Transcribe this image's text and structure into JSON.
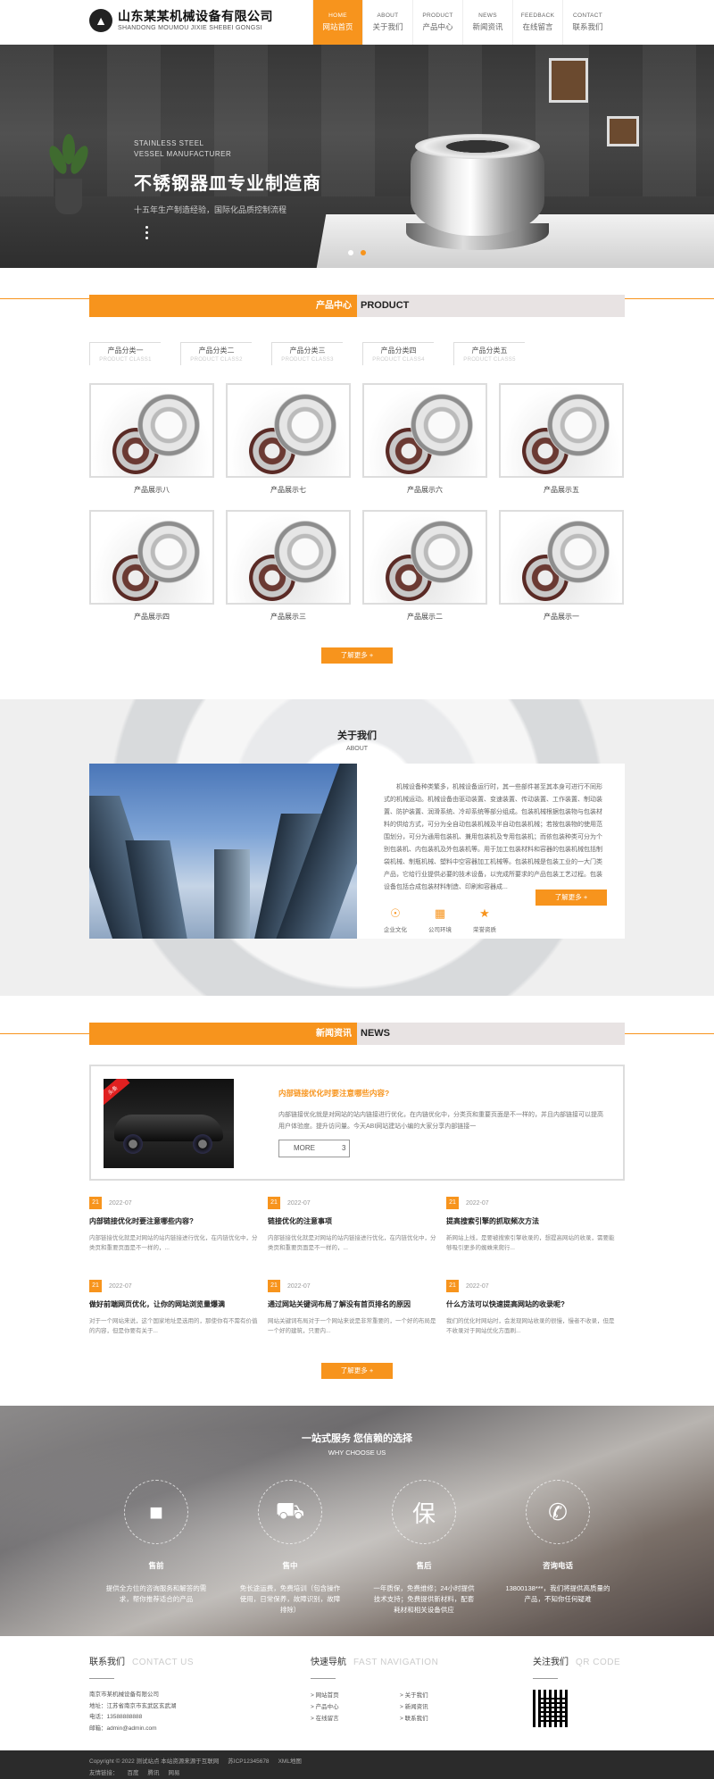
{
  "header": {
    "logo_cn": "山东某某机械设备有限公司",
    "logo_en": "SHANDONG MOUMOU JIXIE SHEBEI GONGSI",
    "nav": [
      {
        "en": "HOME",
        "cn": "网站首页"
      },
      {
        "en": "ABOUT",
        "cn": "关于我们"
      },
      {
        "en": "PRODUCT",
        "cn": "产品中心"
      },
      {
        "en": "NEWS",
        "cn": "新闻资讯"
      },
      {
        "en": "FEEDBACK",
        "cn": "在线留言"
      },
      {
        "en": "CONTACT",
        "cn": "联系我们"
      }
    ]
  },
  "banner": {
    "en1": "STAINLESS STEEL",
    "en2": "VESSEL MANUFACTURER",
    "title": "不锈钢器皿专业制造商",
    "subtitle": "十五年生产制造经验，国际化品质控制流程"
  },
  "products": {
    "title_cn": "产品中心",
    "title_en": "PRODUCT",
    "categories": [
      {
        "cn": "产品分类一",
        "en": "PRODUCT CLASS1"
      },
      {
        "cn": "产品分类二",
        "en": "PRODUCT CLASS2"
      },
      {
        "cn": "产品分类三",
        "en": "PRODUCT CLASS3"
      },
      {
        "cn": "产品分类四",
        "en": "PRODUCT CLASS4"
      },
      {
        "cn": "产品分类五",
        "en": "PRODUCT CLASS5"
      }
    ],
    "items": [
      "产品展示八",
      "产品展示七",
      "产品展示六",
      "产品展示五",
      "产品展示四",
      "产品展示三",
      "产品展示二",
      "产品展示一"
    ],
    "more": "了解更多 +"
  },
  "about": {
    "title_cn": "关于我们",
    "title_en": "ABOUT",
    "text": "机械设备种类繁多，机械设备运行时，其一些部件甚至其本身可进行不同形式的机械运动。机械设备由驱动装置、变速装置、传动装置、工作装置、制动装置、防护装置、润滑系统、冷却系统等部分组成。包装机械根据包装物与包装材料的供给方式，可分为全自动包装机械及半自动包装机械；若按包装物的使用范围划分，可分为通用包装机、兼用包装机及专用包装机；而依包装种类可分为个别包装机、内包装机及外包装机等。用于加工包装材料和容器的包装机械包括制袋机械、制瓶机械、塑料中空容器加工机械等。包装机械是包装工业的一大门类产品，它给行业提供必要的技术设备，以完成所要求的产品包装工艺过程。包装设备包括合成包装材料制造、印刷和容器成...",
    "icons": [
      "企业文化",
      "公司环境",
      "荣誉资质"
    ],
    "more": "了解更多 +"
  },
  "news": {
    "title_cn": "新闻资讯",
    "title_en": "NEWS",
    "featured": {
      "tag": "头条",
      "title": "内部链接优化时要注意哪些内容?",
      "desc": "内部链接优化就是对网站的站内链接进行优化，在内链优化中，分类页和重要页面是不一样的，并且内部链接可以提高用户体验度。提升访问量。今天ABI网站建站小编的大家分享内部链接一",
      "more": "MORE",
      "more_icon": "3"
    },
    "items": [
      {
        "day": "21",
        "date": "2022-07",
        "title": "内部链接优化时要注意哪些内容?",
        "desc": "内部链接优化就是对网站的站内链接进行优化，在内链优化中，分类页和重要页面是不一样的，..."
      },
      {
        "day": "21",
        "date": "2022-07",
        "title": "链接优化的注意事项",
        "desc": "内部链接优化就是对网站的站内链接进行优化，在内链优化中，分类页和重要页面是不一样的，..."
      },
      {
        "day": "21",
        "date": "2022-07",
        "title": "提高搜索引擎的抓取频次方法",
        "desc": "新网站上线，是要被搜索引擎收录的，想提高网站的收录，需要能够吸引更多的蜘蛛来爬行..."
      },
      {
        "day": "21",
        "date": "2022-07",
        "title": "做好前端网页优化，让你的网站浏览量爆满",
        "desc": "对于一个网站来说，这个国家地址是选用的，那使你有不需有价值的内容，但是你要有关于..."
      },
      {
        "day": "21",
        "date": "2022-07",
        "title": "通过网站关键词布局了解没有首页排名的原因",
        "desc": "网站关键词布局对于一个网站来说是非常重要的，一个好的布局是一个好的建筑，只要内..."
      },
      {
        "day": "21",
        "date": "2022-07",
        "title": "什么方法可以快速提高网站的收录呢?",
        "desc": "我们的优化时网站时，会发现网站收录的很慢，慢者不收录，但是不收录对于网站优化方面刷..."
      }
    ],
    "more": "了解更多 +"
  },
  "why": {
    "title_cn": "一站式服务 您信赖的选择",
    "title_en": "WHY CHOOSE US",
    "cols": [
      {
        "icon": "presentation-icon",
        "title": "售前",
        "desc": "提供全方位的咨询服务和解答的需求，帮你推荐适合的产品"
      },
      {
        "icon": "truck-icon",
        "title": "售中",
        "desc": "免长途运费，免费培训（包含操作使用，日常保养，故障识别，故障排除）"
      },
      {
        "icon": "bao-icon",
        "title": "售后",
        "desc": "一年质保，免费维修；24小时提供技术支持；免费提供新材料，配套耗材和相关设备供应"
      },
      {
        "icon": "phone-icon",
        "title": "咨询电话",
        "desc": "13800138***，我们将提供高质量的产品，不知你任何疑难"
      }
    ]
  },
  "footer": {
    "contact_cn": "联系我们",
    "contact_en": "CONTACT US",
    "company": "南京市某机械设备有限公司",
    "address": "地址：江苏省南京市玄武区玄武湖",
    "phone": "电话：13588888888",
    "email": "邮箱：admin@admin.com",
    "nav_cn": "快速导航",
    "nav_en": "FAST NAVIGATION",
    "links": [
      "> 网站首页",
      "> 关于我们",
      "> 产品中心",
      "> 新闻资讯",
      "> 在线留言",
      "> 联系我们"
    ],
    "follow_cn": "关注我们",
    "follow_en": "QR CODE",
    "copyright": "Copyright © 2022 测试站点 本站资源来源于互联网",
    "icp": "苏ICP12345678",
    "xml": "XML地图",
    "friend_label": "友情链接：",
    "friends": [
      "百度",
      "腾讯",
      "网易"
    ]
  },
  "colors": {
    "accent": "#f7941d",
    "dark": "#2b2b2b"
  }
}
